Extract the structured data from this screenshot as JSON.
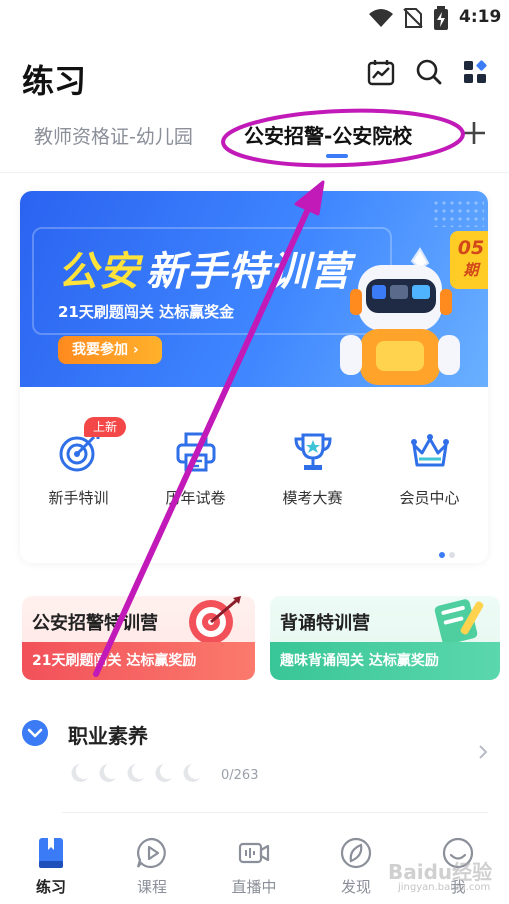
{
  "status_bar": {
    "time": "4:19"
  },
  "header": {
    "title": "练习",
    "icons": [
      "trend-chart-icon",
      "search-icon",
      "apps-grid-icon"
    ]
  },
  "tabs": [
    {
      "label": "教师资格证-幼儿园",
      "active": false
    },
    {
      "label": "公安招警-公安院校",
      "active": true
    }
  ],
  "banner": {
    "title_highlight": "公安",
    "title_rest": "新手特训营",
    "subtitle": "21天刷题闯关 达标赢奖金",
    "cta": "我要参加 ›",
    "issue_number": "05",
    "issue_unit": "期"
  },
  "shortcuts": [
    {
      "label": "新手特训",
      "icon": "target-icon",
      "tag": "上新"
    },
    {
      "label": "历年试卷",
      "icon": "printer-icon"
    },
    {
      "label": "模考大赛",
      "icon": "trophy-icon"
    },
    {
      "label": "会员中心",
      "icon": "crown-icon"
    }
  ],
  "camps": [
    {
      "title": "公安招警特训营",
      "subtitle": "21天刷题闯关 达标赢奖励",
      "art": "dart-target-icon"
    },
    {
      "title": "背诵特训营",
      "subtitle": "趣味背诵闯关 达标赢奖励",
      "art": "notebook-pen-icon"
    }
  ],
  "section": {
    "title": "职业素养",
    "progress": "0/263",
    "stars_total": 5,
    "stars_filled": 0
  },
  "bottom_nav": [
    {
      "label": "练习",
      "icon": "book-icon",
      "active": true
    },
    {
      "label": "课程",
      "icon": "play-bubble-icon",
      "active": false
    },
    {
      "label": "直播中",
      "icon": "live-camera-icon",
      "active": false
    },
    {
      "label": "发现",
      "icon": "compass-icon",
      "active": false
    },
    {
      "label": "我",
      "icon": "profile-icon",
      "active": false
    }
  ],
  "watermark": {
    "brand": "Baidu经验",
    "url": "jingyan.baidu.com"
  },
  "colors": {
    "accent": "#3b7cf6",
    "tag_red": "#f44848",
    "annotation": "#c21ab8",
    "banner_yellow": "#ffe23a"
  }
}
